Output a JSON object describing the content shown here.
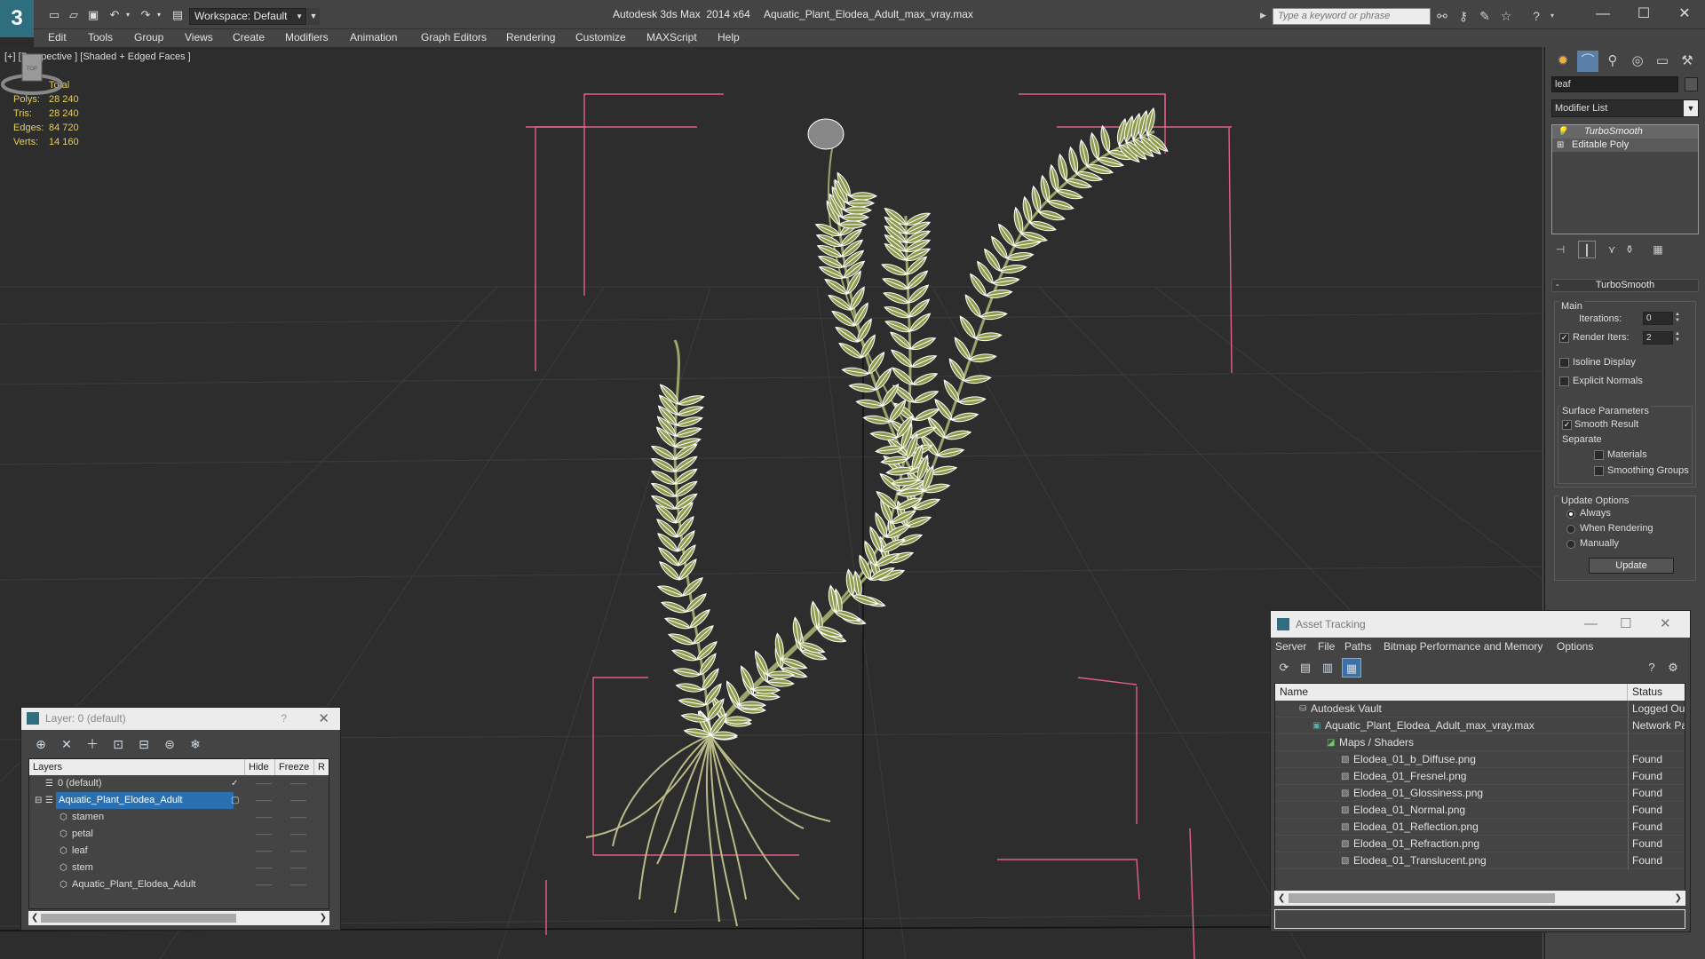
{
  "titlebar": {
    "app_title": "Autodesk 3ds Max  2014 x64",
    "file_name": "Aquatic_Plant_Elodea_Adult_max_vray.max",
    "workspace": "Workspace: Default",
    "search_placeholder": "Type a keyword or phrase",
    "icons": [
      "new-icon",
      "open-icon",
      "save-icon",
      "undo-icon",
      "redo-icon",
      "project-icon",
      "binoculars-icon",
      "key-icon",
      "star-icon",
      "help-icon"
    ],
    "window_controls": [
      "minimize",
      "maximize",
      "close"
    ]
  },
  "menu": [
    "Edit",
    "Tools",
    "Group",
    "Views",
    "Create",
    "Modifiers",
    "Animation",
    "Graph Editors",
    "Rendering",
    "Customize",
    "MAXScript",
    "Help"
  ],
  "viewport": {
    "label": "[+] [Perspective ] [Shaded + Edged Faces ]",
    "stats": {
      "header": "Total",
      "rows": [
        {
          "label": "Polys:",
          "value": "28 240"
        },
        {
          "label": "Tris:",
          "value": "28 240"
        },
        {
          "label": "Edges:",
          "value": "84 720"
        },
        {
          "label": "Verts:",
          "value": "14 160"
        }
      ]
    },
    "viewcube_label": "TOP"
  },
  "command_panel": {
    "object_name": "leaf",
    "modifier_list": "Modifier List",
    "stack": [
      "TurboSmooth",
      "Editable Poly"
    ],
    "rollout_title": "TurboSmooth",
    "main_group": "Main",
    "iterations_label": "Iterations:",
    "iterations_value": "0",
    "render_iters_label": "Render Iters:",
    "render_iters_value": "2",
    "render_iters_checked": true,
    "isoline_label": "Isoline Display",
    "explicit_normals_label": "Explicit Normals",
    "surface_group": "Surface Parameters",
    "smooth_result_label": "Smooth Result",
    "separate_label": "Separate",
    "materials_label": "Materials",
    "smoothing_groups_label": "Smoothing Groups",
    "update_group": "Update Options",
    "always_label": "Always",
    "when_rendering_label": "When Rendering",
    "manually_label": "Manually",
    "update_button": "Update"
  },
  "layer_window": {
    "title": "Layer: 0 (default)",
    "help": "?",
    "columns": [
      "Layers",
      "Hide",
      "Freeze",
      "R"
    ],
    "rows": [
      {
        "name": "0 (default)",
        "level": 0,
        "current": true
      },
      {
        "name": "Aquatic_Plant_Elodea_Adult",
        "level": 0,
        "selected": true
      },
      {
        "name": "stamen",
        "level": 1
      },
      {
        "name": "petal",
        "level": 1
      },
      {
        "name": "leaf",
        "level": 1
      },
      {
        "name": "stem",
        "level": 1
      },
      {
        "name": "Aquatic_Plant_Elodea_Adult",
        "level": 1
      }
    ]
  },
  "asset_window": {
    "title": "Asset Tracking",
    "menu": [
      "Server",
      "File",
      "Paths",
      "Bitmap Performance and Memory",
      "Options"
    ],
    "columns": [
      "Name",
      "Status"
    ],
    "rows": [
      {
        "name": "Autodesk Vault",
        "level": 1,
        "status": "Logged Out"
      },
      {
        "name": "Aquatic_Plant_Elodea_Adult_max_vray.max",
        "level": 2,
        "status": "Network Path"
      },
      {
        "name": "Maps / Shaders",
        "level": 3,
        "status": ""
      },
      {
        "name": "Elodea_01_b_Diffuse.png",
        "level": 4,
        "status": "Found"
      },
      {
        "name": "Elodea_01_Fresnel.png",
        "level": 4,
        "status": "Found"
      },
      {
        "name": "Elodea_01_Glossiness.png",
        "level": 4,
        "status": "Found"
      },
      {
        "name": "Elodea_01_Normal.png",
        "level": 4,
        "status": "Found"
      },
      {
        "name": "Elodea_01_Reflection.png",
        "level": 4,
        "status": "Found"
      },
      {
        "name": "Elodea_01_Refraction.png",
        "level": 4,
        "status": "Found"
      },
      {
        "name": "Elodea_01_Translucent.png",
        "level": 4,
        "status": "Found"
      }
    ]
  },
  "colors": {
    "stats_text": "#e3cf5c",
    "bounding_box": "#e0608a",
    "selection": "#2a6fb0",
    "leaf_fill": "#8f9a4d"
  }
}
